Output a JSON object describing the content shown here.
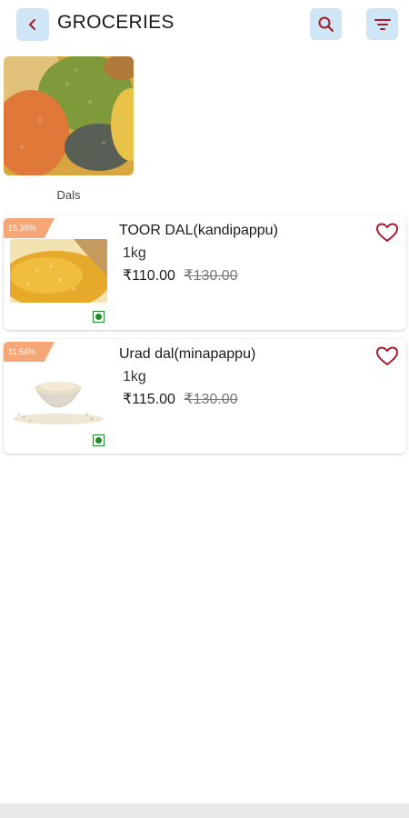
{
  "header": {
    "title": "GROCERIES",
    "back_icon": "chevron-left-icon",
    "search_icon": "search-icon",
    "filter_icon": "filter-icon"
  },
  "categories": [
    {
      "label": "Dals"
    }
  ],
  "products": [
    {
      "discount": "15.38%",
      "name": "TOOR DAL(kandipappu)",
      "quantity": "1kg",
      "price": "₹110.00",
      "mrp": "₹130.00"
    },
    {
      "discount": "11.54%",
      "name": "Urad dal(minapappu)",
      "quantity": "1kg",
      "price": "₹115.00",
      "mrp": "₹130.00"
    }
  ],
  "colors": {
    "accent_button_bg": "#cfe6f7",
    "icon_red": "#a61c2a",
    "badge": "#f6a777",
    "veg_green": "#1f8a2e"
  }
}
